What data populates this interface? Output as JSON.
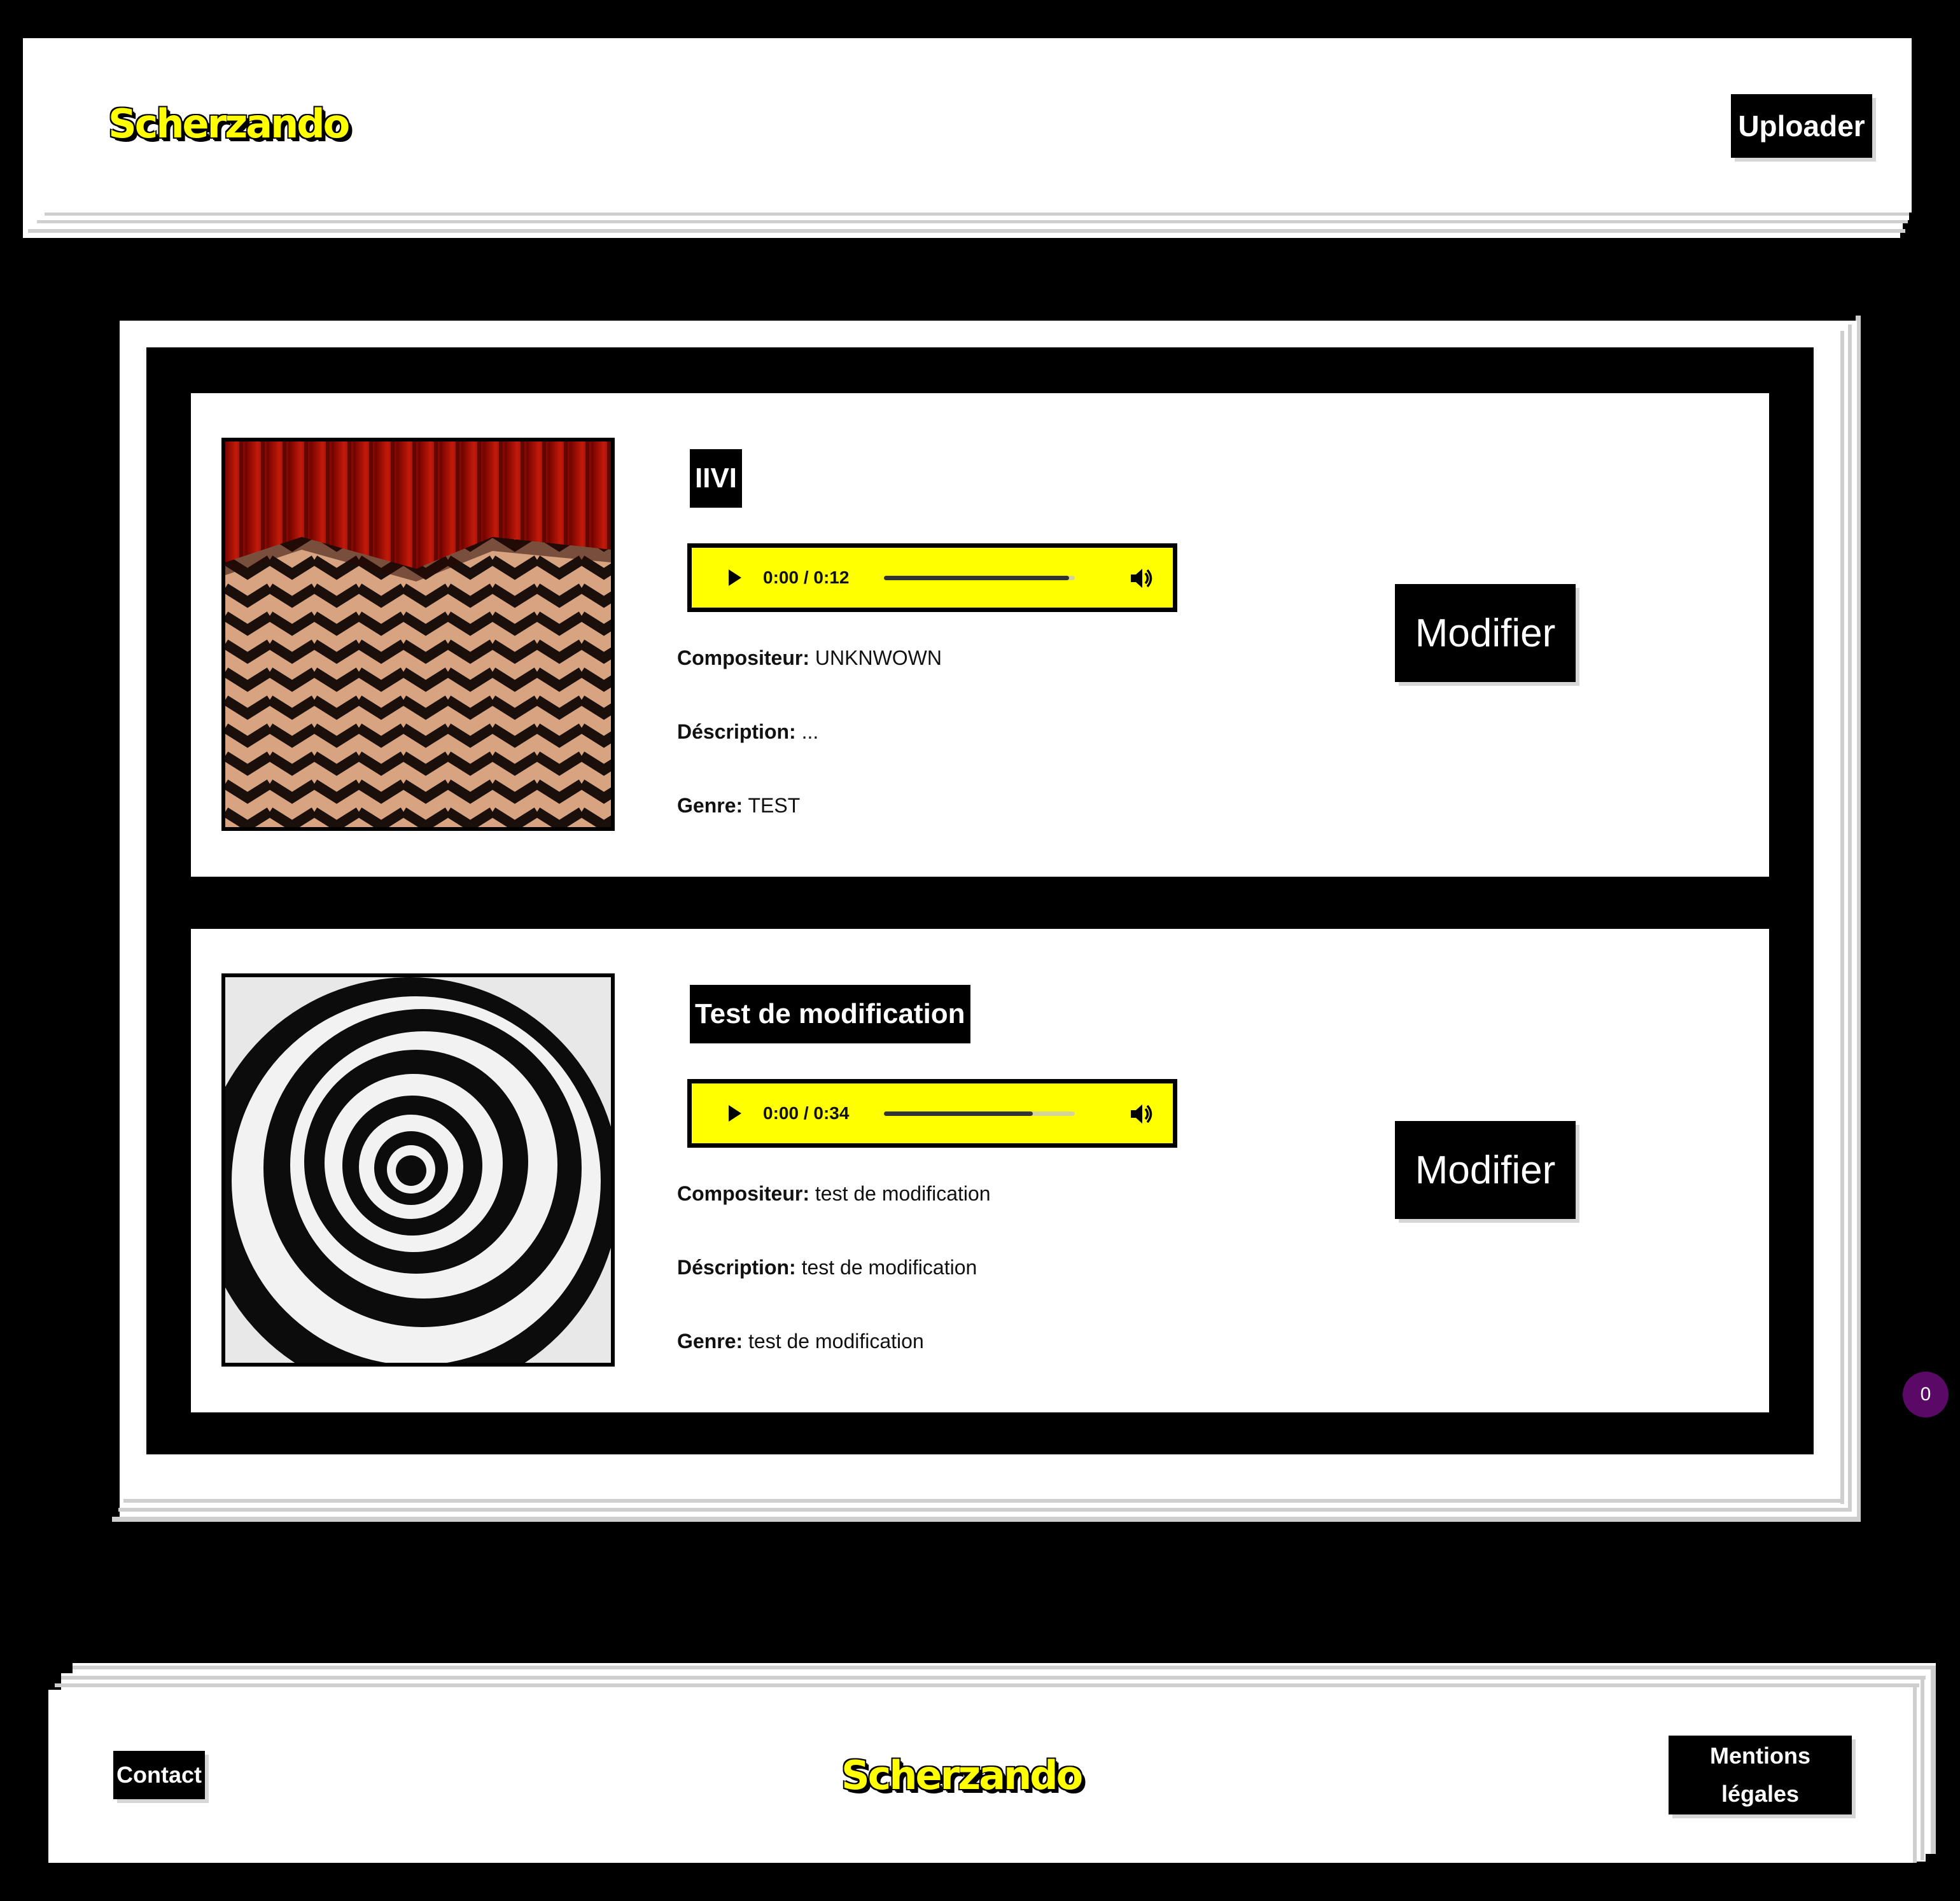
{
  "header": {
    "logo_text": "Scherzando",
    "upload_label": "Uploader"
  },
  "tracks": [
    {
      "title": "IIVI",
      "cover_icon": "curtain-zigzag-floor-image",
      "player": {
        "current": "0:00",
        "duration": " / 0:12",
        "progress": 0.97
      },
      "composer_label": "Compositeur:",
      "composer_value": "UNKNWOWN",
      "description_label": "Déscription:",
      "description_value": "...",
      "genre_label": "Genre:",
      "genre_value": "TEST",
      "modify_label": "Modifier"
    },
    {
      "title": "Test de modification",
      "cover_icon": "spiral-vortex-image",
      "player": {
        "current": "0:00",
        "duration": " / 0:34",
        "progress": 0.78
      },
      "composer_label": "Compositeur:",
      "composer_value": "test de modification",
      "description_label": "Déscription:",
      "description_value": "test de modification",
      "genre_label": "Genre:",
      "genre_value": "test de modification",
      "modify_label": "Modifier"
    }
  ],
  "notification_count": "0",
  "footer": {
    "contact_label": "Contact",
    "logo_text": "Scherzando",
    "legal_line1": "Mentions",
    "legal_line2": "légales"
  },
  "colors": {
    "accent_yellow": "#ffff00",
    "background": "#000000",
    "card": "#ffffff",
    "badge": "#5a0a66"
  }
}
